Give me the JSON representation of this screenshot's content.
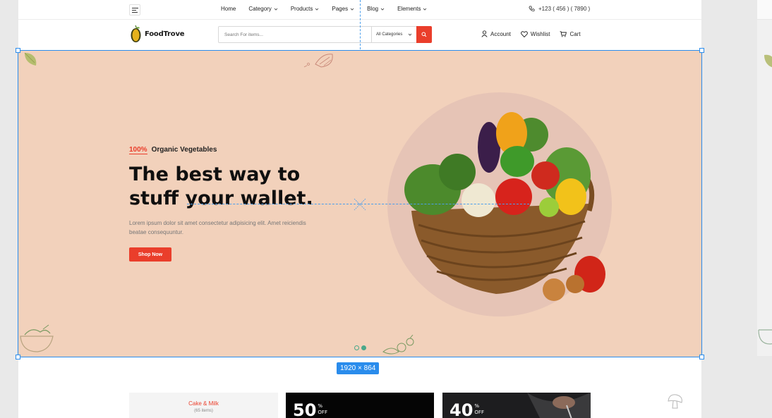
{
  "nav": {
    "items": [
      {
        "label": "Home",
        "dropdown": false
      },
      {
        "label": "Category",
        "dropdown": true
      },
      {
        "label": "Products",
        "dropdown": true
      },
      {
        "label": "Pages",
        "dropdown": true
      },
      {
        "label": "Blog",
        "dropdown": true
      },
      {
        "label": "Elements",
        "dropdown": true
      }
    ],
    "phone": "+123 ( 456 ) ( 7890 )"
  },
  "header": {
    "logo_text": "FoodTrove",
    "search_placeholder": "Search For items...",
    "category_select": "All Categories",
    "account": "Account",
    "wishlist": "Wishlist",
    "cart": "Cart"
  },
  "hero": {
    "tag_percent": "100%",
    "tag_text": "Organic Vegetables",
    "title_line1": "The best way to",
    "title_line2": "stuff your wallet.",
    "description": "Lorem ipsum dolor sit amet consectetur adipisicing elit. Amet reiciendis beatae consequuntur.",
    "cta": "Shop Now",
    "slides_total": 2,
    "active_slide": 2
  },
  "selection": {
    "size_label": "1920 × 864"
  },
  "cards": {
    "card1_title": "Cake & Milk",
    "card1_count": "(65 items)",
    "card2_value": "50",
    "card3_value": "40",
    "percent_sign": "%",
    "off_label": "OFF"
  },
  "colors": {
    "accent": "#ea3e2b",
    "hero_bg": "#f2d1bb",
    "selection": "#2a8cec",
    "dot": "#4aa88a"
  }
}
